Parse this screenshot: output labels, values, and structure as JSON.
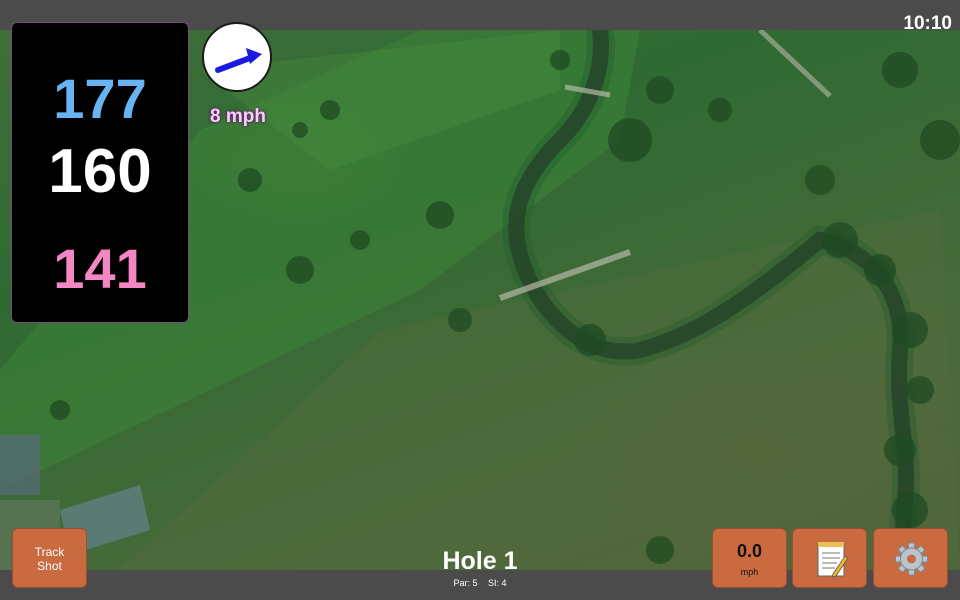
{
  "status": {
    "time": "10:10"
  },
  "yardage": {
    "back": "177",
    "middle": "160",
    "front": "141"
  },
  "wind": {
    "speed": "8 mph",
    "icon": "wind-arrow-icon"
  },
  "hole": {
    "title": "Hole 1",
    "par": "Par: 5",
    "si": "SI: 4"
  },
  "buttons": {
    "track_line1": "Track",
    "track_line2": "Shot",
    "speed_value": "0.0",
    "speed_unit": "mph",
    "notes_icon": "notepad-icon",
    "settings_icon": "gear-icon"
  },
  "colors": {
    "back": "#68b4f3",
    "middle": "#ffffff",
    "front": "#f287c4",
    "button": "#c96a41"
  }
}
